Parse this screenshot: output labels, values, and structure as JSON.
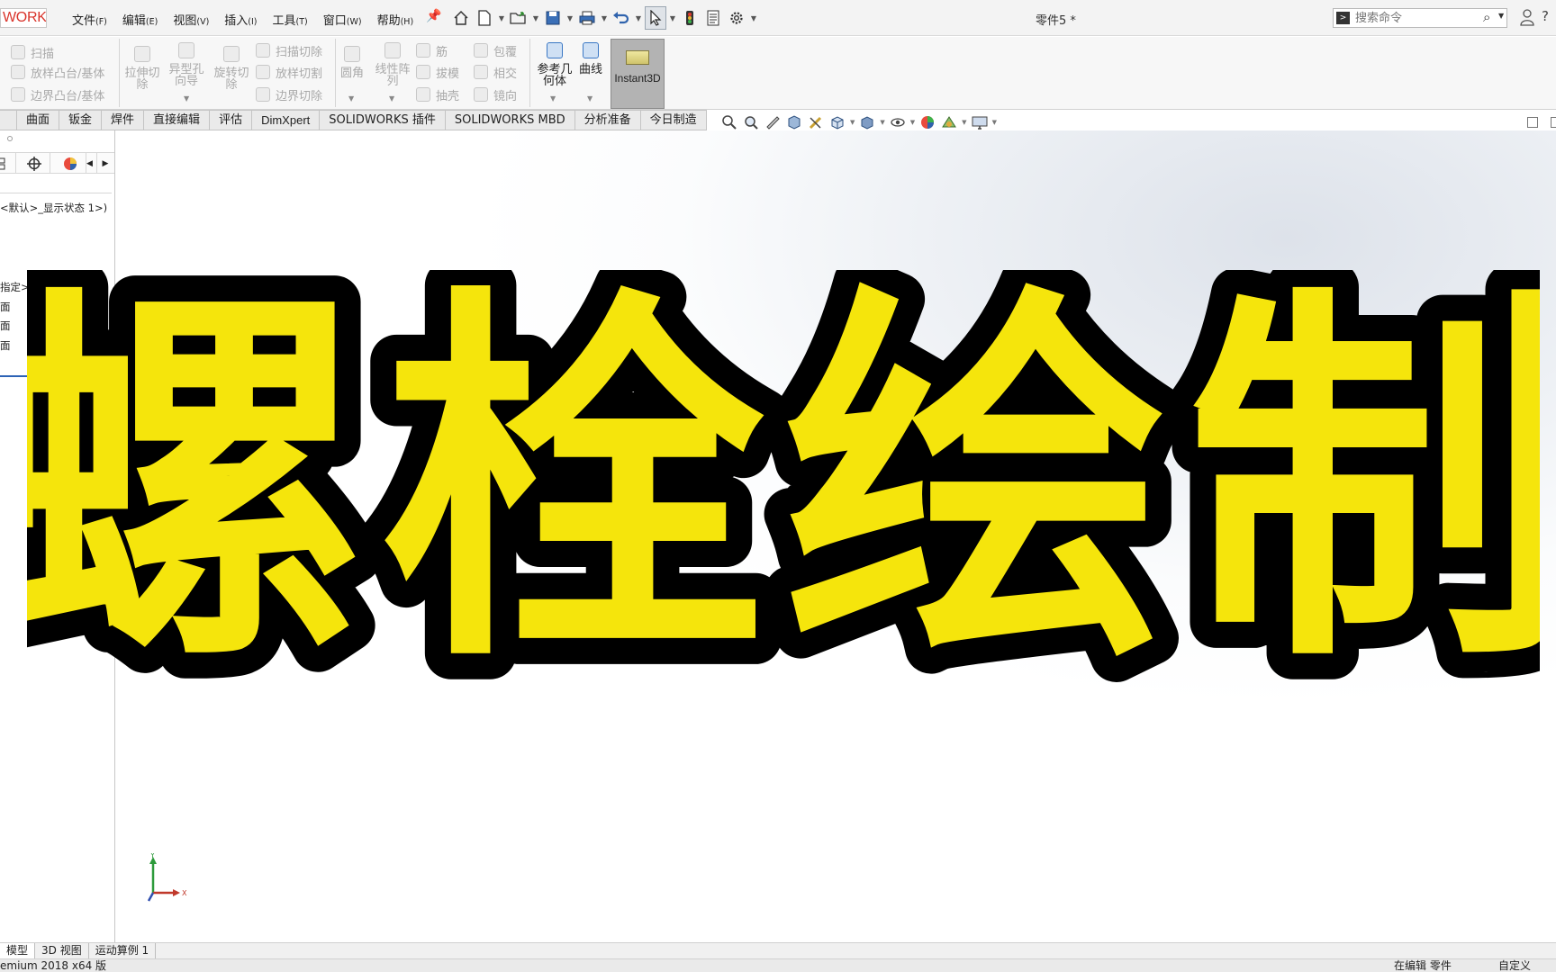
{
  "app": {
    "logo_text": "WORKS",
    "doc_title": "零件5 *"
  },
  "menu": [
    {
      "label": "文件",
      "key": "(F)"
    },
    {
      "label": "编辑",
      "key": "(E)"
    },
    {
      "label": "视图",
      "key": "(V)"
    },
    {
      "label": "插入",
      "key": "(I)"
    },
    {
      "label": "工具",
      "key": "(T)"
    },
    {
      "label": "窗口",
      "key": "(W)"
    },
    {
      "label": "帮助",
      "key": "(H)"
    }
  ],
  "search": {
    "placeholder": "搜索命令"
  },
  "ribbon": {
    "sweep": "扫描",
    "loft_boss": "放样凸台/基体",
    "boundary_boss": "边界凸台/基体",
    "extrude_cut": "拉伸切除",
    "hole_wizard": "异型孔向导",
    "revolve_cut": "旋转切除",
    "sweep_cut": "扫描切除",
    "loft_cut": "放样切割",
    "boundary_cut": "边界切除",
    "fillet": "圆角",
    "linear_pattern": "线性阵列",
    "rib": "筋",
    "draft": "拔模",
    "shell": "抽壳",
    "wrap": "包覆",
    "intersect": "相交",
    "mirror": "镜向",
    "ref_geometry": "参考几何体",
    "curves": "曲线",
    "instant3d": "Instant3D"
  },
  "tabs": [
    "曲面",
    "钣金",
    "焊件",
    "直接编辑",
    "评估",
    "DimXpert",
    "SOLIDWORKS 插件",
    "SOLIDWORKS MBD",
    "分析准备",
    "今日制造"
  ],
  "feature_tree": {
    "display_state": "<默认>_显示状态 1>)",
    "material": "指定>",
    "plane1": "面",
    "plane2": "面",
    "plane3": "面"
  },
  "overlay": {
    "title": "螺栓绘制",
    "fill_color": "#f5e50c",
    "stroke_color": "#000000"
  },
  "triad": {
    "y": "Y",
    "x": "X"
  },
  "bottom_tabs": [
    "模型",
    "3D 视图",
    "运动算例 1"
  ],
  "status": {
    "left": "emium 2018 x64 版",
    "mid": "在编辑 零件",
    "right": "自定义"
  },
  "colors": {
    "accent": "#1f6fc5",
    "logo_red": "#d9342b",
    "instant3d_bg": "#b3b3b3"
  }
}
